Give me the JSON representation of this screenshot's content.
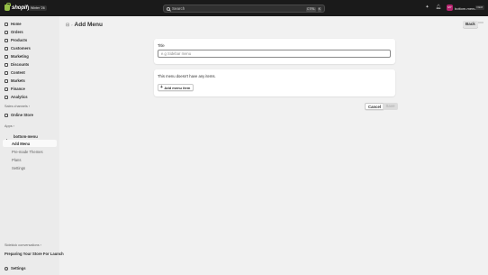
{
  "topbar": {
    "logo_text": "shopify",
    "badge": "Winter '26",
    "search": {
      "placeholder": "Search",
      "shortcut_1": "CTRL",
      "shortcut_2": "K"
    },
    "store": {
      "avatar": "MY",
      "name": "bottom-menu",
      "badge": "DEM"
    }
  },
  "sidebar": {
    "nav": [
      {
        "label": "Home",
        "icon": "home-icon"
      },
      {
        "label": "Orders",
        "icon": "orders-icon"
      },
      {
        "label": "Products",
        "icon": "products-icon"
      },
      {
        "label": "Customers",
        "icon": "customers-icon"
      },
      {
        "label": "Marketing",
        "icon": "marketing-icon"
      },
      {
        "label": "Discounts",
        "icon": "discounts-icon"
      },
      {
        "label": "Content",
        "icon": "content-icon"
      },
      {
        "label": "Markets",
        "icon": "markets-icon"
      },
      {
        "label": "Finance",
        "icon": "finance-icon"
      },
      {
        "label": "Analytics",
        "icon": "analytics-icon"
      }
    ],
    "sales_channels_label": "Sales channels",
    "online_store": "Online Store",
    "apps_label": "Apps",
    "app_name": "bottom-menu",
    "app_sub": [
      "Add Menu",
      "Pre-made Themes",
      "Plans",
      "Settings"
    ],
    "sidekick_label": "Sidekick conversations",
    "sidekick_item": "Preparing Your Store For Launch",
    "settings": "Settings"
  },
  "main": {
    "title": "Add Menu",
    "back_label": "Back",
    "more_label": "⋯",
    "title_field": {
      "label": "Title",
      "placeholder": "e.g Sidebar menu"
    },
    "empty_text": "This menu doesn't have any items.",
    "add_item_label": "Add menu item",
    "cancel_label": "Cancel",
    "save_label": "Save"
  }
}
